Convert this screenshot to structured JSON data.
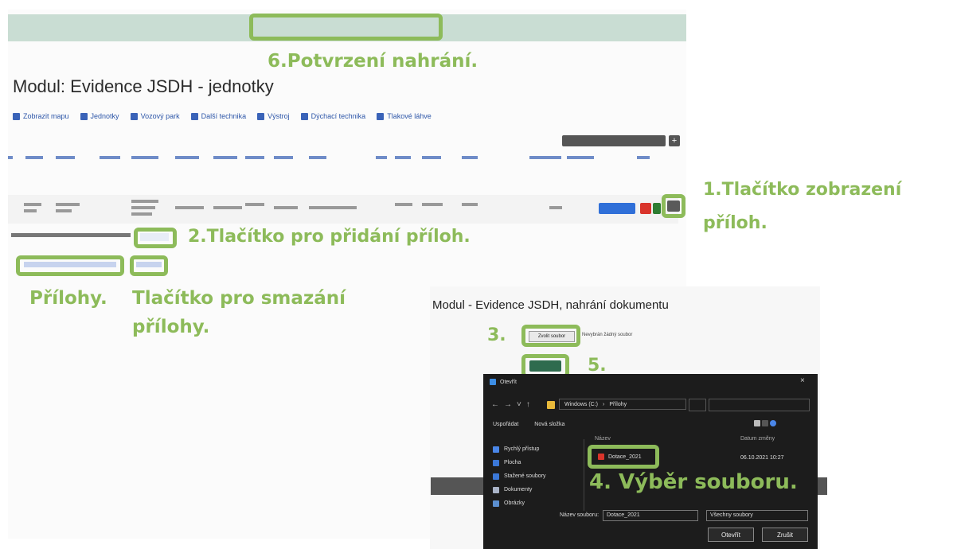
{
  "module_title": "Modul: Evidence JSDH - jednotky",
  "annotations": {
    "a6": "6.Potvrzení nahrání.",
    "a1_line1": "1.Tlačítko zobrazení",
    "a1_line2": "příloh.",
    "a2": "2.Tlačítko pro přidání příloh.",
    "attachments": "Přílohy.",
    "delete_line1": "Tlačítko pro smazání",
    "delete_line2": "přílohy.",
    "a3": "3.",
    "a5": "5.",
    "a4": "4. Výběr souboru."
  },
  "toolbar": {
    "items": [
      "Zobrazit mapu",
      "Jednotky",
      "Vozový park",
      "Další technika",
      "Výstroj",
      "Dýchací technika",
      "Tlakové láhve"
    ]
  },
  "upload_dialog": {
    "title": "Modul - Evidence JSDH, nahrání dokumentu",
    "choose_file": "Zvolit soubor",
    "no_file": "Nevybrán žádný soubor"
  },
  "file_dialog": {
    "title": "Otevřít",
    "path_drive": "Windows (C:)",
    "path_folder": "Přílohy",
    "organize": "Uspořádat",
    "new_folder": "Nová složka",
    "sidebar": [
      "Rychlý přístup",
      "Plocha",
      "Stažené soubory",
      "Dokumenty",
      "Obrázky"
    ],
    "col_name": "Název",
    "col_date": "Datum změny",
    "file_name": "Dotace_2021",
    "file_date": "06.10.2021 10:27",
    "filename_label": "Název souboru:",
    "filename_value": "Dotace_2021",
    "filetype": "Všechny soubory",
    "open": "Otevřít",
    "cancel": "Zrušit"
  },
  "colors": {
    "annotation_green": "#8dbb5a",
    "banner_bg": "#c9ddd3",
    "link_blue": "#2d56a8"
  }
}
